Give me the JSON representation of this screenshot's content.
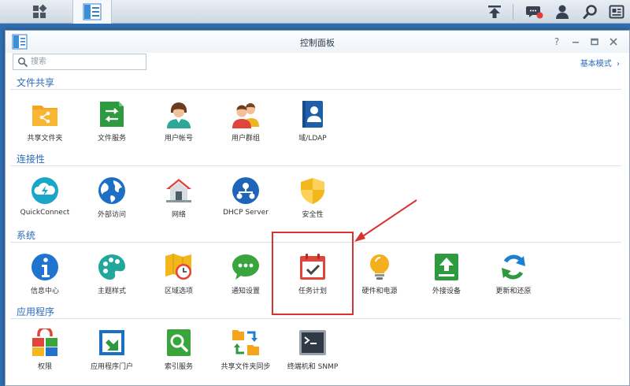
{
  "window": {
    "title": "控制面板"
  },
  "search": {
    "placeholder": "搜索"
  },
  "basic_mode": {
    "label": "基本模式"
  },
  "sections": [
    {
      "title": "文件共享",
      "items": [
        {
          "label": "共享文件夹",
          "icon": "shared-folder-icon"
        },
        {
          "label": "文件服务",
          "icon": "file-services-icon"
        },
        {
          "label": "用户帐号",
          "icon": "user-icon"
        },
        {
          "label": "用户群组",
          "icon": "group-icon"
        },
        {
          "label": "域/LDAP",
          "icon": "domain-ldap-icon"
        }
      ]
    },
    {
      "title": "连接性",
      "items": [
        {
          "label": "QuickConnect",
          "icon": "quickconnect-icon"
        },
        {
          "label": "外部访问",
          "icon": "external-access-icon"
        },
        {
          "label": "网络",
          "icon": "network-icon"
        },
        {
          "label": "DHCP Server",
          "icon": "dhcp-server-icon"
        },
        {
          "label": "安全性",
          "icon": "security-icon"
        }
      ]
    },
    {
      "title": "系统",
      "items": [
        {
          "label": "信息中心",
          "icon": "info-center-icon"
        },
        {
          "label": "主题样式",
          "icon": "theme-icon"
        },
        {
          "label": "区域选项",
          "icon": "regional-options-icon"
        },
        {
          "label": "通知设置",
          "icon": "notification-icon"
        },
        {
          "label": "任务计划",
          "icon": "task-scheduler-icon"
        },
        {
          "label": "硬件和电源",
          "icon": "hardware-power-icon"
        },
        {
          "label": "外接设备",
          "icon": "external-devices-icon"
        },
        {
          "label": "更新和还原",
          "icon": "update-restore-icon"
        }
      ]
    },
    {
      "title": "应用程序",
      "items": [
        {
          "label": "权限",
          "icon": "privileges-icon"
        },
        {
          "label": "应用程序门户",
          "icon": "application-portal-icon"
        },
        {
          "label": "索引服务",
          "icon": "indexing-service-icon"
        },
        {
          "label": "共享文件夹同步",
          "icon": "shared-folder-sync-icon"
        },
        {
          "label": "终端机和 SNMP",
          "icon": "terminal-snmp-icon"
        }
      ]
    }
  ],
  "colors": {
    "accent": "#2a6bbd",
    "highlight": "#d8312f"
  }
}
